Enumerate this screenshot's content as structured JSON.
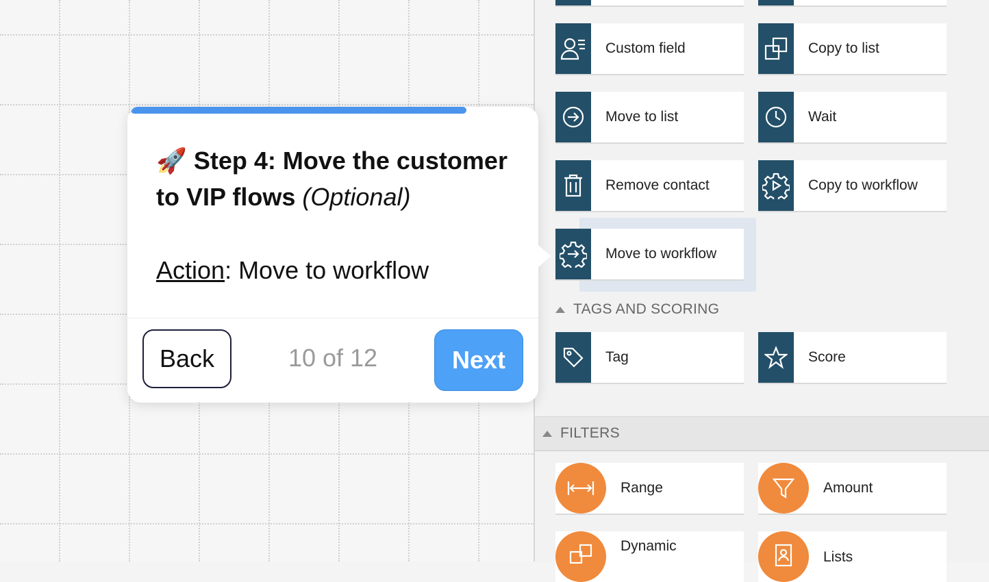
{
  "tour": {
    "progress": 0.83,
    "title_emoji": "🚀",
    "title_main": "Step 4: Move the customer to VIP flows",
    "title_optional": "(Optional)",
    "action_label": "Action",
    "action_value": ": Move to workflow",
    "back_label": "Back",
    "counter": "10 of 12",
    "next_label": "Next"
  },
  "actions": [
    {
      "label": "Custom field",
      "icon": "custom-field-icon"
    },
    {
      "label": "Copy to list",
      "icon": "copy-icon"
    },
    {
      "label": "Move to list",
      "icon": "arrow-circle-icon"
    },
    {
      "label": "Wait",
      "icon": "clock-icon"
    },
    {
      "label": "Remove contact",
      "icon": "trash-icon"
    },
    {
      "label": "Copy to workflow",
      "icon": "gear-play-icon"
    },
    {
      "label": "Move to workflow",
      "icon": "gear-arrow-icon"
    }
  ],
  "tags_section": {
    "title": "TAGS AND SCORING",
    "items": [
      {
        "label": "Tag",
        "icon": "tag-icon"
      },
      {
        "label": "Score",
        "icon": "star-icon"
      }
    ]
  },
  "filters_section": {
    "title": "FILTERS",
    "items": [
      {
        "label": "Range",
        "icon": "range-icon"
      },
      {
        "label": "Amount",
        "icon": "funnel-icon"
      },
      {
        "label": "Dynamic",
        "icon": "dynamic-icon"
      },
      {
        "label": "Lists",
        "icon": "contact-list-icon"
      }
    ]
  },
  "colors": {
    "action_icon_bg": "#234f68",
    "filter_icon_bg": "#f08a3c",
    "next_button": "#4da1f7",
    "progress": "#4a94ee"
  }
}
